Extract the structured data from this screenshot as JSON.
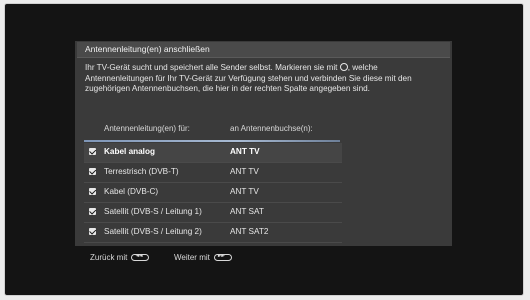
{
  "dialog": {
    "title": "Antennenleitung(en) anschließen",
    "intro_part1": "Ihr TV-Gerät sucht und speichert alle Sender selbst. Markieren sie mit",
    "intro_part2": ", welche Antennenleitungen für Ihr TV-Gerät zur Verfügung stehen und verbinden Sie diese mit den zugehörigen Antennenbuchsen, die hier in der rechten Spalte angegeben sind.",
    "col_left": "Antennenleitung(en) für:",
    "col_right": "an Antennenbuchse(n):",
    "rows": [
      {
        "label": "Kabel analog",
        "socket": "ANT TV",
        "checked": true,
        "selected": true
      },
      {
        "label": "Terrestrisch (DVB-T)",
        "socket": "ANT TV",
        "checked": true,
        "selected": false
      },
      {
        "label": "Kabel (DVB-C)",
        "socket": "ANT TV",
        "checked": true,
        "selected": false
      },
      {
        "label": "Satellit (DVB-S / Leitung 1)",
        "socket": "ANT SAT",
        "checked": true,
        "selected": false
      },
      {
        "label": "Satellit (DVB-S / Leitung 2)",
        "socket": "ANT SAT2",
        "checked": true,
        "selected": false
      }
    ]
  },
  "footer": {
    "back_label": "Zurück mit",
    "back_icon_glyph": "◄◄",
    "next_label": "Weiter mit",
    "next_icon_glyph": "►►"
  }
}
